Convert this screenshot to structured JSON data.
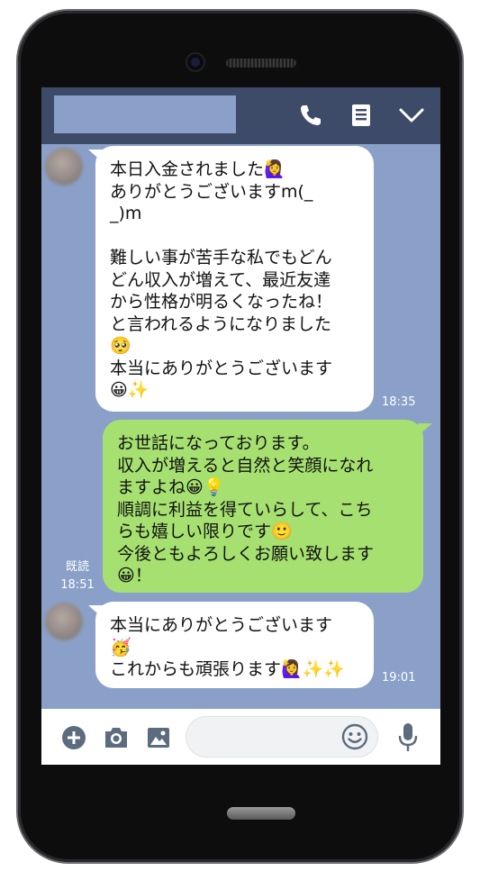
{
  "header": {
    "icons": [
      "phone-icon",
      "menu-icon",
      "chevron-down-icon"
    ]
  },
  "messages": [
    {
      "side": "received",
      "lines": [
        "本日入金されました🙋‍♀️",
        "ありがとうございますm(_",
        "_)m",
        "",
        "難しい事が苦手な私でもどん",
        "どん収入が増えて、最近友達",
        "から性格が明るくなったね！",
        "と言われるようになりました",
        "🥺",
        "本当にありがとうございます",
        "😀✨"
      ],
      "time": "18:35"
    },
    {
      "side": "sent",
      "lines": [
        "お世話になっております。",
        "収入が増えると自然と笑顔になれ",
        "ますよね😀💡",
        "順調に利益を得ていらして、こち",
        "らも嬉しい限りです🙂",
        "今後ともよろしくお願い致します",
        "😀！"
      ],
      "read": "既読",
      "time": "18:51"
    },
    {
      "side": "received",
      "lines": [
        "本当にありがとうございます",
        "🥳",
        "これからも頑張ります🙋‍♀️✨✨"
      ],
      "time": "19:01"
    }
  ],
  "footer": {
    "input_placeholder": "",
    "icons": [
      "plus-icon",
      "camera-icon",
      "image-icon",
      "smiley-icon",
      "microphone-icon"
    ]
  },
  "colors": {
    "header": "#3d4b68",
    "background": "#8aa0c8",
    "sent_bubble": "#a6e071",
    "received_bubble": "#ffffff"
  }
}
